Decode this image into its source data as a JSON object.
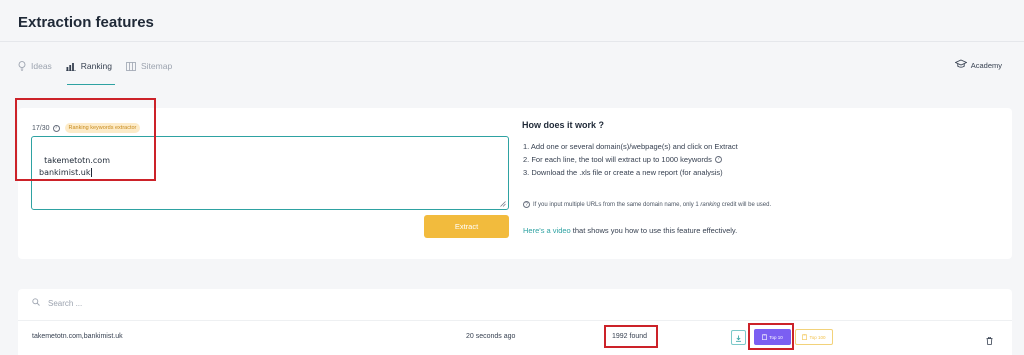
{
  "header": {
    "title": "Extraction features"
  },
  "tabs": [
    {
      "label": "Ideas",
      "icon": "lightbulb-icon",
      "active": false
    },
    {
      "label": "Ranking",
      "icon": "bar-chart-icon",
      "active": true
    },
    {
      "label": "Sitemap",
      "icon": "sitemap-icon",
      "active": false
    }
  ],
  "academy": {
    "label": "Academy",
    "icon": "graduation-cap-icon"
  },
  "extractor": {
    "counter": "17/30",
    "tag": "Ranking keywords extractor",
    "input_value": "takemetotn.com\nbankimist.uk",
    "button": "Extract"
  },
  "how": {
    "title": "How does it work ?",
    "steps": [
      "1. Add one or several domain(s)/webpage(s) and click on Extract",
      "2. For each line, the tool will extract up to 1000 keywords",
      "3. Download the .xls file or create a new report (for analysis)"
    ],
    "note_before": "If you input multiple URLs from the same domain name, only 1 ",
    "note_em": "ranking",
    "note_after": " credit will be used.",
    "video_link": "Here's a video",
    "video_rest": " that shows you how to use this feature effectively."
  },
  "list": {
    "search_placeholder": "Search ...",
    "rows": [
      {
        "urls": "takemetotn.com,bankimist.uk",
        "time": "20 seconds ago",
        "found": "1992 found",
        "top10": "Top 10",
        "top100": "Top 100"
      }
    ]
  },
  "colors": {
    "accent": "#2ea2a2",
    "extract_button": "#f2bb3d",
    "top10": "#7b5ff2",
    "annotation": "#cc2229"
  }
}
